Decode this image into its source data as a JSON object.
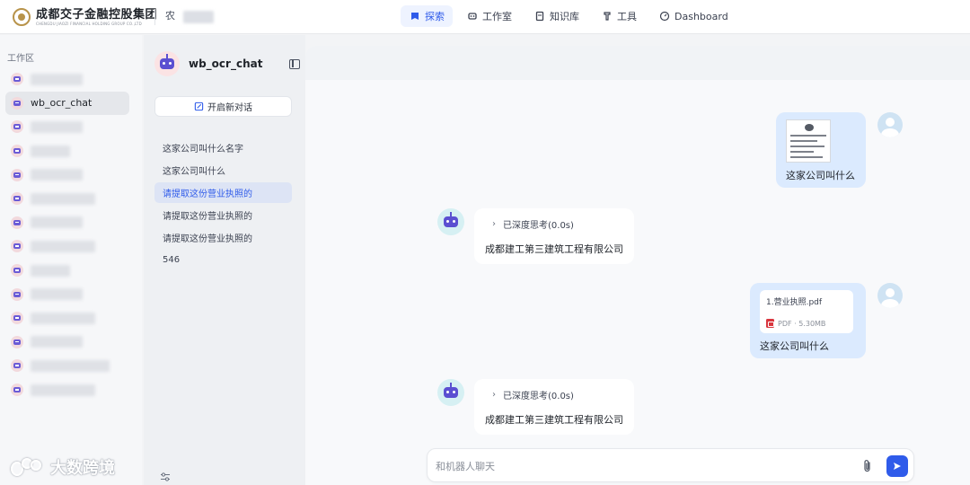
{
  "brand": {
    "name": "成都交子金融控股集团",
    "en": "CHENGDU JIAOZI FINANCIAL HOLDING GROUP CO.,LTD"
  },
  "header": {
    "workspace_chip": "农"
  },
  "nav": {
    "items": [
      {
        "label": "探索",
        "icon": "compass-icon",
        "active": true
      },
      {
        "label": "工作室",
        "icon": "robot-icon",
        "active": false
      },
      {
        "label": "知识库",
        "icon": "book-icon",
        "active": false
      },
      {
        "label": "工具",
        "icon": "wrench-icon",
        "active": false
      },
      {
        "label": "Dashboard",
        "icon": "gauge-icon",
        "active": false
      }
    ]
  },
  "rail": {
    "title": "工作区",
    "active_item": "wb_ocr_chat"
  },
  "watermark": {
    "text": "大数跨境"
  },
  "conversation": {
    "title": "wb_ocr_chat",
    "new_chat_label": "开启新对话",
    "history": [
      {
        "label": "这家公司叫什么名字",
        "active": false
      },
      {
        "label": "这家公司叫什么",
        "active": false
      },
      {
        "label": "请提取这份营业执照的",
        "active": true
      },
      {
        "label": "请提取这份营业执照的",
        "active": false
      },
      {
        "label": "请提取这份营业执照的",
        "active": false
      },
      {
        "label": "546",
        "active": false
      }
    ]
  },
  "messages": {
    "user1": {
      "text": "这家公司叫什么",
      "attachment": "image-thumbnail"
    },
    "bot1": {
      "thinking": "已深度思考(0.0s)",
      "answer": "成都建工第三建筑工程有限公司"
    },
    "user2": {
      "text": "这家公司叫什么",
      "file_name": "1.营业执照.pdf",
      "file_meta": "PDF · 5.30MB"
    },
    "bot2": {
      "thinking": "已深度思考(0.0s)",
      "answer": "成都建工第三建筑工程有限公司"
    }
  },
  "composer": {
    "placeholder": "和机器人聊天"
  },
  "colors": {
    "accent": "#2f5bea",
    "user_bubble": "#dbeafe",
    "active_history": "#dde4f5"
  }
}
